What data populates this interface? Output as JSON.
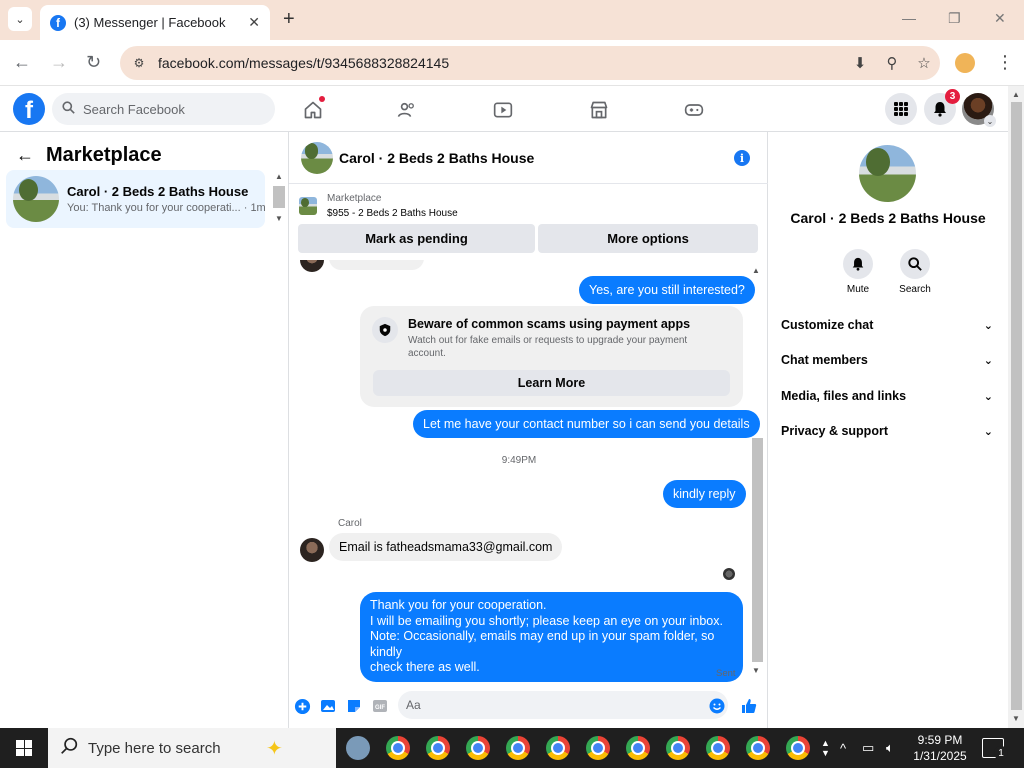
{
  "browser": {
    "tab_title": "(3) Messenger | Facebook",
    "url": "facebook.com/messages/t/9345688328824145"
  },
  "fb": {
    "search_placeholder": "Search Facebook",
    "notification_count": "3",
    "brand_color": "#1877f2"
  },
  "left": {
    "title": "Marketplace",
    "conversations": [
      {
        "name": "Carol · 2 Beds 2 Baths House",
        "snippet": "You: Thank you for your cooperati... · 1m"
      }
    ]
  },
  "chat": {
    "title": "Carol · 2 Beds 2 Baths House",
    "listing_source": "Marketplace",
    "listing_price_title": "$955 - 2 Beds 2 Baths House",
    "mark_pending_label": "Mark as pending",
    "more_options_label": "More options",
    "messages": {
      "m1": "Yes, are you still interested?",
      "m2": "Let me have your contact number so i can send you details",
      "m3": "kindly reply",
      "m4": "Email is fatheadsmama33@gmail.com",
      "m5_l1": "Thank you for your cooperation.",
      "m5_l2": "I will be emailing you shortly; please keep an eye on your inbox.",
      "m5_l3": "Note: Occasionally, emails may end up in your spam folder, so kindly",
      "m5_l4": "check there as well."
    },
    "scam_title": "Beware of common scams using payment apps",
    "scam_body": "Watch out for fake emails or requests to upgrade your payment account.",
    "learn_more_label": "Learn More",
    "timestamp": "9:49PM",
    "sender_name": "Carol",
    "sent_label": "Sent",
    "composer_placeholder": "Aa",
    "outgoing_color": "#0a7cff"
  },
  "right": {
    "name": "Carol · 2 Beds 2 Baths House",
    "mute_label": "Mute",
    "search_label": "Search",
    "sections": [
      "Customize chat",
      "Chat members",
      "Media, files and links",
      "Privacy & support"
    ]
  },
  "taskbar": {
    "search_placeholder": "Type here to search",
    "time": "9:59 PM",
    "date": "1/31/2025",
    "notification_count": "1"
  }
}
